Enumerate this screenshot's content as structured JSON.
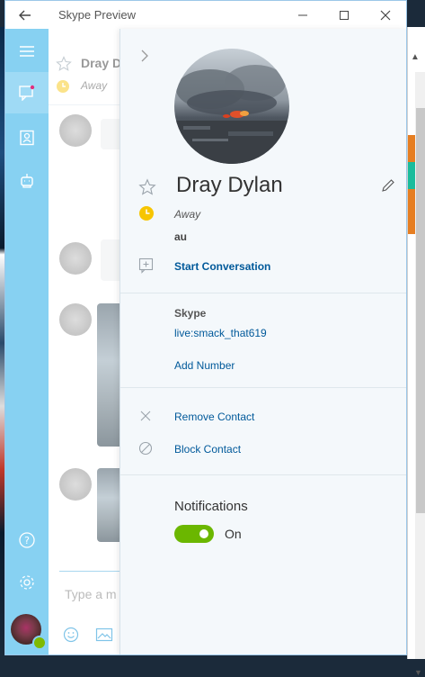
{
  "window": {
    "title": "Skype Preview"
  },
  "conversation": {
    "contact_name": "Dray D",
    "status": "Away",
    "compose_placeholder": "Type a m"
  },
  "profile": {
    "name": "Dray Dylan",
    "status": "Away",
    "mood": "au",
    "start_conversation": "Start Conversation",
    "skype_label": "Skype",
    "skype_id": "live:smack_that619",
    "add_number": "Add Number",
    "remove_contact": "Remove Contact",
    "block_contact": "Block Contact",
    "notifications_label": "Notifications",
    "notifications_state": "On",
    "notifications_on": true
  },
  "colors": {
    "rail": "#87d1f2",
    "link": "#00599a",
    "toggle_on": "#6bb700",
    "away": "#f7c500"
  }
}
